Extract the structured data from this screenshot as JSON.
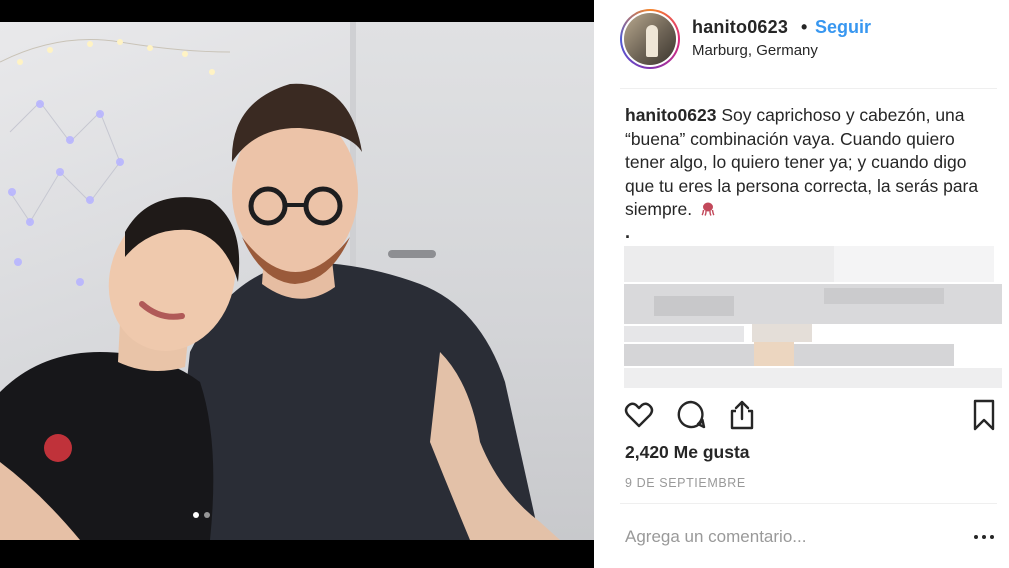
{
  "post": {
    "username": "hanito0623",
    "separator": "•",
    "follow_label": "Seguir",
    "location": "Marburg, Germany",
    "caption_user": "hanito0623",
    "caption_text": "Soy caprichoso y cabezón, una “buena” combinación vaya. Cuando quiero tener algo, lo quiero tener ya; y cuando digo que tu eres la persona correcta, la serás para siempre.",
    "caption_dot": ".",
    "likes": "2,420 Me gusta",
    "date": "9 de septiembre",
    "carousel_pages": 2,
    "carousel_active": 0
  },
  "comment": {
    "placeholder": "Agrega un comentario..."
  },
  "icons": {
    "like": "heart-icon",
    "comment": "speech-bubble-icon",
    "share": "share-upload-icon",
    "save": "bookmark-icon",
    "more": "ellipsis-icon",
    "caption_emoji": "octopus-icon"
  },
  "colors": {
    "follow_blue": "#3897f0",
    "text": "#262626",
    "muted": "#999999"
  }
}
